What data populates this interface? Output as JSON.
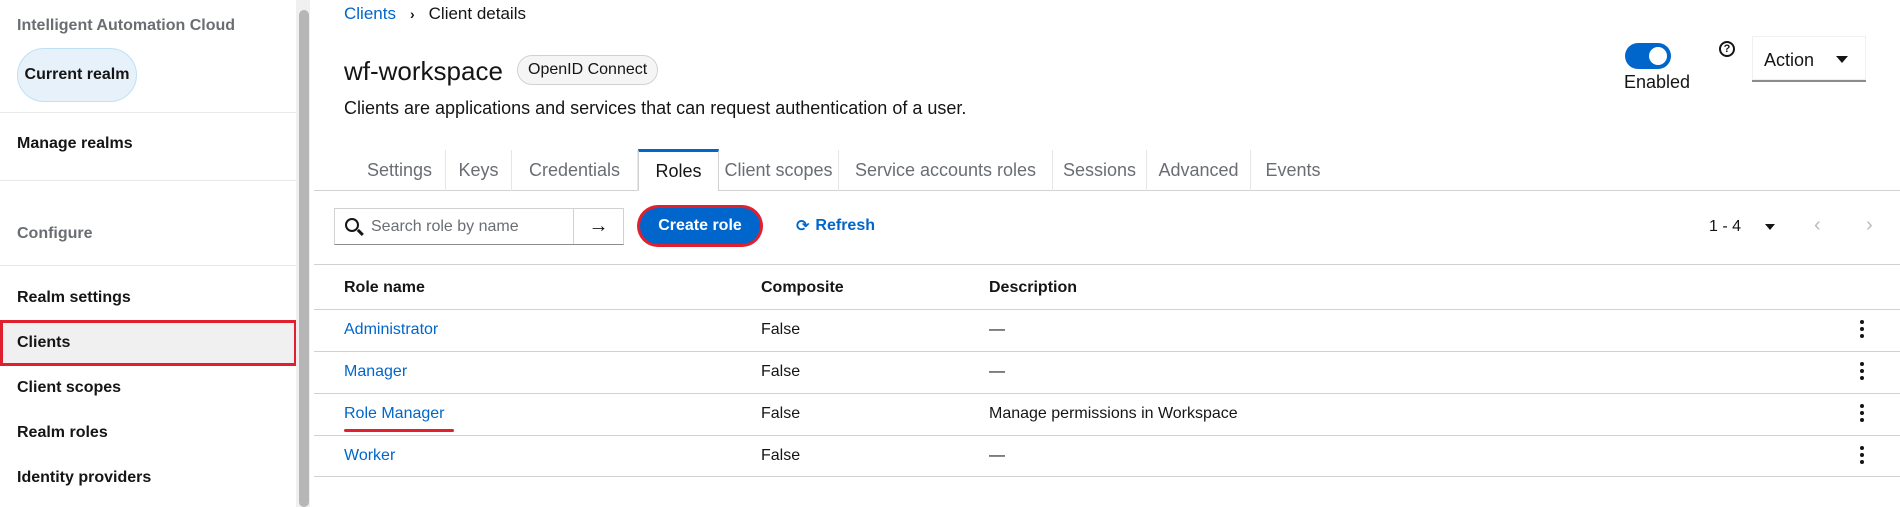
{
  "sidebar": {
    "app_title": "Intelligent Automation Cloud",
    "realm_button": "Current realm",
    "manage_realms": "Manage realms",
    "configure_heading": "Configure",
    "items": [
      "Realm settings",
      "Clients",
      "Client scopes",
      "Realm roles",
      "Identity providers"
    ]
  },
  "breadcrumb": {
    "parent": "Clients",
    "current": "Client details"
  },
  "client": {
    "name": "wf-workspace",
    "protocol_badge": "OpenID Connect",
    "description": "Clients are applications and services that can request authentication of a user."
  },
  "header_controls": {
    "enabled_label": "Enabled",
    "enabled": true,
    "help_glyph": "?",
    "action_label": "Action"
  },
  "tabs": [
    "Settings",
    "Keys",
    "Credentials",
    "Roles",
    "Client scopes",
    "Service accounts roles",
    "Sessions",
    "Advanced",
    "Events"
  ],
  "active_tab": "Roles",
  "toolbar": {
    "search_placeholder": "Search role by name",
    "create_role": "Create role",
    "refresh": "Refresh",
    "pagination": "1 - 4"
  },
  "table": {
    "headers": [
      "Role name",
      "Composite",
      "Description"
    ],
    "rows": [
      {
        "name": "Administrator",
        "composite": "False",
        "description": "—"
      },
      {
        "name": "Manager",
        "composite": "False",
        "description": "—"
      },
      {
        "name": "Role Manager",
        "composite": "False",
        "description": "Manage permissions in Workspace"
      },
      {
        "name": "Worker",
        "composite": "False",
        "description": "—"
      }
    ]
  },
  "colors": {
    "accent": "#0066cc",
    "highlight": "#e0202e"
  }
}
